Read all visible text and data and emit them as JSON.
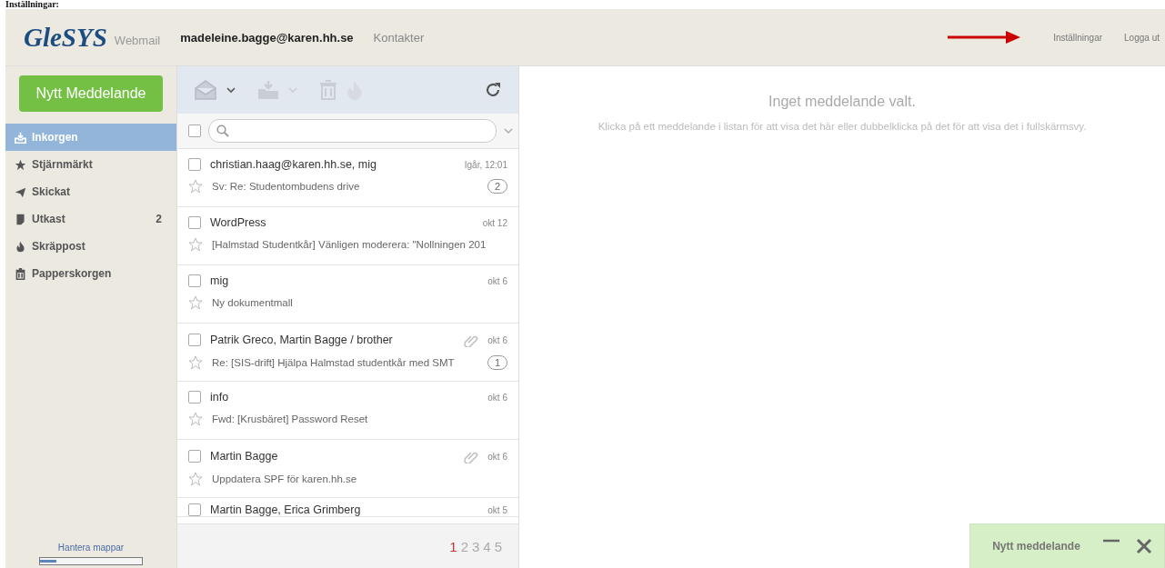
{
  "caption": "Inställningar:",
  "header": {
    "logo": "GleSYS",
    "product": "Webmail",
    "user": "madeleine.bagge@karen.hh.se",
    "nav": [
      "Kontakter"
    ],
    "right_links": [
      "Inställningar",
      "Logga ut"
    ]
  },
  "sidebar": {
    "compose_button": "Nytt Meddelande",
    "folders": [
      {
        "name": "Inkorgen",
        "selected": true
      },
      {
        "name": "Stjärnmärkt",
        "selected": false
      },
      {
        "name": "Skickat",
        "selected": false
      },
      {
        "name": "Utkast",
        "selected": false,
        "count": "2"
      },
      {
        "name": "Skräppost",
        "selected": false
      },
      {
        "name": "Papperskorgen",
        "selected": false
      }
    ],
    "manage_link": "Hantera mappar",
    "quota": {
      "level": 0.16
    }
  },
  "select_all": {
    "checked": false
  },
  "messages": [
    {
      "sender": "christian.haag@karen.hh.se, mig",
      "date": "Igår, 12:01",
      "subject": "Sv: Re: Studentombudens drive",
      "thread_count": "2",
      "attachment": false,
      "starred": false,
      "checked": false
    },
    {
      "sender": "WordPress",
      "date": "okt 12",
      "subject": "[Halmstad Studentkår] Vänligen moderera: \"Nollningen 201",
      "attachment": false,
      "starred": false,
      "checked": false
    },
    {
      "sender": "mig",
      "date": "okt 6",
      "subject": "Ny dokumentmall",
      "attachment": false,
      "starred": false,
      "checked": false
    },
    {
      "sender": "Patrik Greco, Martin Bagge / brother",
      "date": "okt 6",
      "subject": "Re: [SIS-drift] Hjälpa Halmstad studentkår med SMT",
      "thread_count": "1",
      "attachment": true,
      "starred": false,
      "checked": false
    },
    {
      "sender": "info",
      "date": "okt 6",
      "subject": "Fwd: [Krusbäret] Password Reset",
      "attachment": false,
      "starred": false,
      "checked": false
    },
    {
      "sender": "Martin Bagge",
      "date": "okt 6",
      "subject": "Uppdatera SPF för karen.hh.se",
      "attachment": true,
      "starred": false,
      "checked": false
    },
    {
      "sender": "Martin Bagge, Erica Grimberg",
      "date": "okt 5",
      "checked": false
    }
  ],
  "pager": [
    {
      "label": "1",
      "selected": true
    },
    {
      "label": "2",
      "selected": false
    },
    {
      "label": "3",
      "selected": false
    },
    {
      "label": "4",
      "selected": false
    },
    {
      "label": "5",
      "selected": false
    }
  ],
  "preview": {
    "title": "Inget meddelande valt.",
    "hint": "Klicka på ett meddelande i listan för att visa det här eller dubbelklicka på det för att visa det i fullskärmsvy."
  },
  "compose_panel": {
    "title": "Nytt meddelande"
  }
}
